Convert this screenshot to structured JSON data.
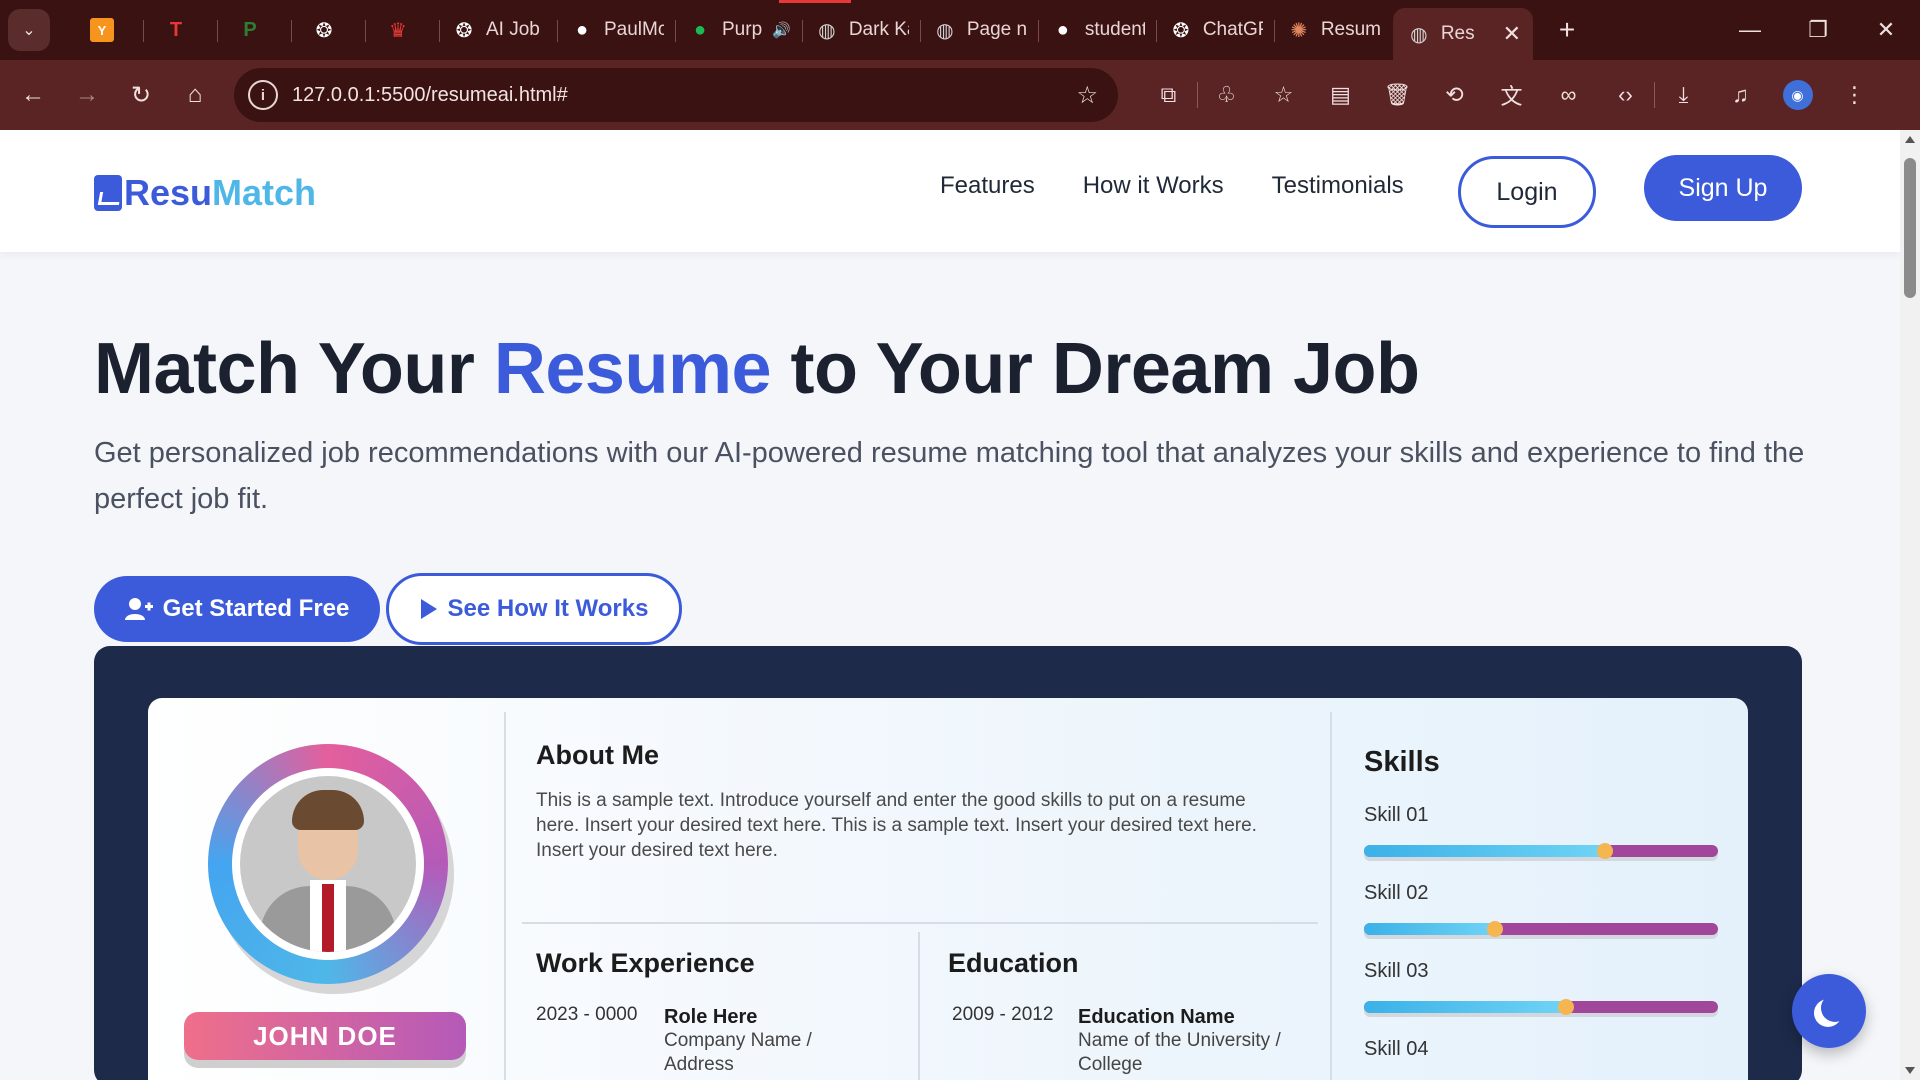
{
  "browser": {
    "tabs": [
      {
        "label": "",
        "icon": "y-icon",
        "icon_color": "#f7941d"
      },
      {
        "label": "",
        "icon": "tj-icon",
        "icon_color": "#e53935"
      },
      {
        "label": "",
        "icon": "p-logo-icon",
        "icon_color": "#2e7d32"
      },
      {
        "label": "",
        "icon": "openai-icon",
        "icon_color": "#ffffff"
      },
      {
        "label": "",
        "icon": "crown-icon",
        "icon_color": "#e53935"
      },
      {
        "label": "AI Job M",
        "icon": "openai-icon",
        "icon_color": "#ffffff"
      },
      {
        "label": "PaulMc",
        "icon": "github-icon",
        "icon_color": "#ffffff"
      },
      {
        "label": "Purp",
        "icon": "spotify-icon",
        "icon_color": "#1db954",
        "audio": true
      },
      {
        "label": "Dark Ka",
        "icon": "globe-icon",
        "icon_color": "#d0d0d0"
      },
      {
        "label": "Page no",
        "icon": "globe-icon",
        "icon_color": "#d0d0d0"
      },
      {
        "label": "student",
        "icon": "student-icon",
        "icon_color": "#ffffff"
      },
      {
        "label": "ChatGP",
        "icon": "openai-icon",
        "icon_color": "#ffffff"
      },
      {
        "label": "Resume",
        "icon": "claude-icon",
        "icon_color": "#e0875f"
      },
      {
        "label": "Res",
        "icon": "globe-icon",
        "icon_color": "#d0d0d0",
        "active": true
      }
    ],
    "url": "127.0.0.1:5500/resumeai.html#"
  },
  "site": {
    "logo_part1": "Resu",
    "logo_part2": "Match",
    "nav": [
      "Features",
      "How it Works",
      "Testimonials"
    ],
    "login": "Login",
    "signup": "Sign Up",
    "accent_color": "#3b5bdb"
  },
  "hero": {
    "title_before": "Match Your ",
    "title_accent": "Resume",
    "title_after": " to Your Dream Job",
    "subtitle": "Get personalized job recommendations with our AI-powered resume matching tool that analyzes your skills and experience to find the perfect job fit.",
    "cta_primary": "Get Started Free",
    "cta_secondary": "See How It Works"
  },
  "resume": {
    "name": "JOHN DOE",
    "about_heading": "About Me",
    "about_text": "This is a sample text. Introduce yourself and enter the good skills to put on a resume here. Insert your desired text here. This is a sample text. Insert your desired text here. Insert your desired text here.",
    "work_heading": "Work Experience",
    "work": {
      "years": "2023 - 0000",
      "title": "Role Here",
      "detail": "Company Name / Address"
    },
    "education_heading": "Education",
    "education": {
      "years": "2009 - 2012",
      "title": "Education Name",
      "detail": "Name of the University / College"
    },
    "skills_heading": "Skills",
    "skills": [
      {
        "label": "Skill 01",
        "level": 0.68
      },
      {
        "label": "Skill 02",
        "level": 0.37
      },
      {
        "label": "Skill 03",
        "level": 0.57
      },
      {
        "label": "Skill 04",
        "level": null
      }
    ]
  }
}
